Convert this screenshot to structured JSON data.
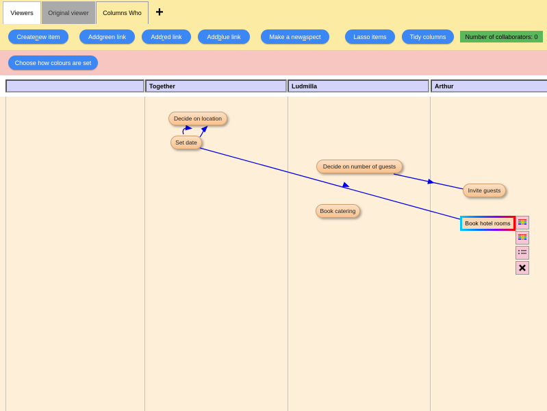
{
  "tabs": {
    "viewers": "Viewers",
    "original": "Original viewer",
    "columns": "Columns Who",
    "add": "+"
  },
  "toolbar": {
    "create": {
      "pre": "Create ",
      "u": "n",
      "post": "ew item"
    },
    "green": {
      "pre": "Add ",
      "u": "g",
      "post": "reen link"
    },
    "red": {
      "pre": "Add ",
      "u": "r",
      "post": "ed link"
    },
    "blue": {
      "pre": "Add ",
      "u": "b",
      "post": "lue link"
    },
    "aspect": {
      "pre": "Make a new ",
      "u": "a",
      "post": "spect"
    },
    "lasso": "Lasso items",
    "tidy": "Tidy columns",
    "collaborators": "Number of collaborators: 0"
  },
  "colours_button": "Choose how colours are set",
  "columns": [
    "",
    "Together",
    "Ludmilla",
    "Arthur"
  ],
  "items": {
    "location": "Decide on location",
    "date": "Set date",
    "guests_number": "Decide on number of guests",
    "invite": "Invite guests",
    "catering": "Book catering",
    "hotel": "Book hotel rooms"
  },
  "icons": [
    "palette-icon",
    "palette-icon",
    "list-icon",
    "close-icon"
  ],
  "colors": {
    "link": "#0000ee",
    "button": "#3b87f5",
    "collab": "#5bb85a"
  }
}
